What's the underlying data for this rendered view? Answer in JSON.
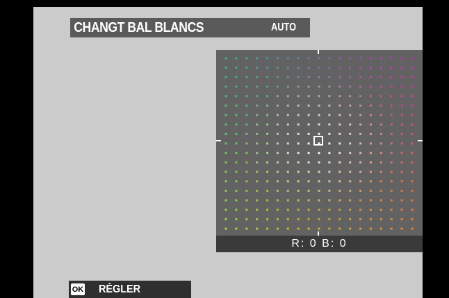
{
  "title_bar": {
    "title": "CHANGT BAL BLANCS",
    "mode": "AUTO"
  },
  "wb_shift": {
    "r_label": "R:",
    "r_value": "0",
    "b_label": "B:",
    "b_value": "0"
  },
  "footer": {
    "ok_key": "OK",
    "action_label": "RÉGLER"
  },
  "colors": {
    "screen_bg": "#cbcbcb",
    "grid_panel_bg": "#626262",
    "readout_bg": "#3a3a3a",
    "title_bg": "#5a5a5a"
  }
}
